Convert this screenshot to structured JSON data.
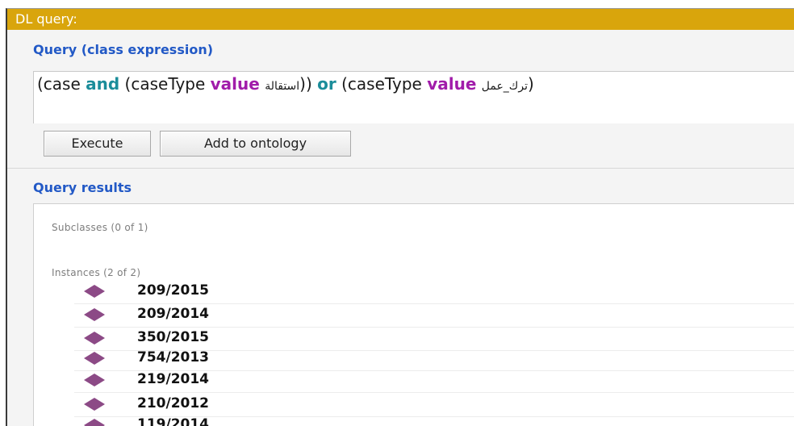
{
  "window": {
    "title": "DL query:"
  },
  "query_section": {
    "label": "Query (class expression)",
    "expression": {
      "t1": "(case ",
      "and": "and",
      "t2": " (caseType ",
      "value1": "value",
      "t3": " ",
      "arabic1": "استقالة",
      "t4": ")) ",
      "or": "or",
      "t5": " (caseType ",
      "value2": "value",
      "t6": " ",
      "arabic2": "ترك_عمل",
      "t7": ")"
    }
  },
  "buttons": {
    "execute": "Execute",
    "add_to_ontology": "Add to ontology"
  },
  "results_section": {
    "label": "Query results",
    "subclasses_label": "Subclasses (0 of 1)",
    "instances_label": "Instances (2 of 2)",
    "instances": [
      "209/2015",
      "209/2014",
      "350/2015",
      "754/2013",
      "219/2014",
      "210/2012",
      "119/2014"
    ]
  },
  "colors": {
    "title_bar": "#d9a50c",
    "section_label": "#2259c6",
    "keyword_and_or": "#1b8d9a",
    "keyword_value": "#a11caa",
    "instance_icon": "#8c4a86"
  },
  "icons": {
    "instance": "purple-diamond-individual-icon"
  }
}
